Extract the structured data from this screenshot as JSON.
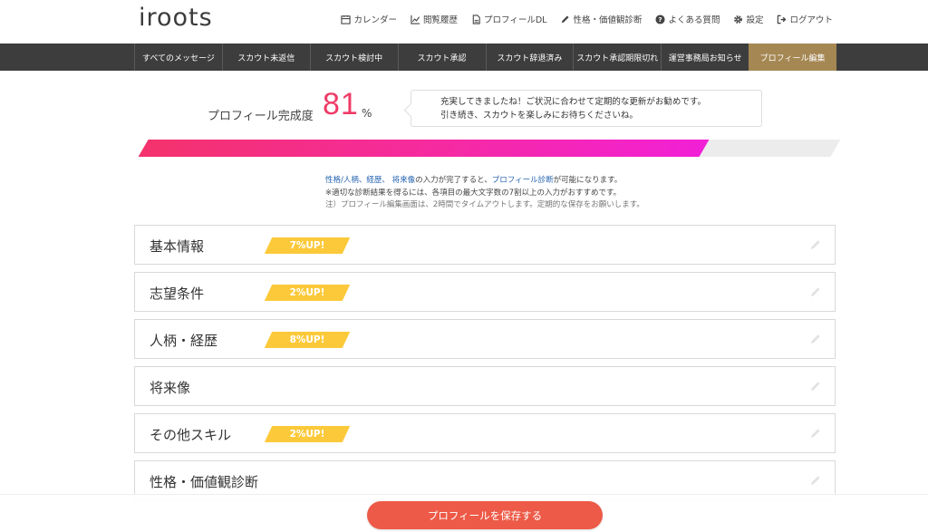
{
  "header": {
    "logo": "iroots",
    "nav": [
      {
        "label": "カレンダー",
        "icon": "calendar-icon"
      },
      {
        "label": "閲覧履歴",
        "icon": "chart-icon"
      },
      {
        "label": "プロフィールDL",
        "icon": "pdf-icon"
      },
      {
        "label": "性格・価値観診断",
        "icon": "pencil-icon"
      },
      {
        "label": "よくある質問",
        "icon": "question-icon"
      },
      {
        "label": "設定",
        "icon": "gear-icon"
      },
      {
        "label": "ログアウト",
        "icon": "logout-icon"
      }
    ]
  },
  "tabs": [
    {
      "label": "すべてのメッセージ",
      "active": false
    },
    {
      "label": "スカウト未返信",
      "active": false
    },
    {
      "label": "スカウト検討中",
      "active": false
    },
    {
      "label": "スカウト承認",
      "active": false
    },
    {
      "label": "スカウト辞退済み",
      "active": false
    },
    {
      "label": "スカウト承認期限切れ",
      "active": false
    },
    {
      "label": "運営事務局お知らせ",
      "active": false
    },
    {
      "label": "プロフィール編集",
      "active": true
    }
  ],
  "completion": {
    "label": "プロフィール完成度",
    "value": "81",
    "unit": "%",
    "percent": 81,
    "message_line1": "充実してきましたね！ご状況に合わせて定期的な更新がお勧めです。",
    "message_line2": "引き続き、スカウトを楽しみにお待ちくださいね。"
  },
  "notes": {
    "link1": "性格/人柄、経歴、 将来像",
    "mid1": "の入力が完了すると、",
    "link2": "プロフィール診断",
    "end1": "が可能になります。",
    "line2": "※適切な診断結果を得るには、各項目の最大文字数の7割以上の入力がおすすめです。",
    "line3": "注）プロフィール編集画面は、2時間でタイムアウトします。定期的な保存をお願いします。"
  },
  "sections": [
    {
      "title": "基本情報",
      "badge": "7%UP!"
    },
    {
      "title": "志望条件",
      "badge": "2%UP!"
    },
    {
      "title": "人柄・経歴",
      "badge": "8%UP!"
    },
    {
      "title": "将来像",
      "badge": ""
    },
    {
      "title": "その他スキル",
      "badge": "2%UP!"
    },
    {
      "title": "性格・価値観診断",
      "badge": ""
    }
  ],
  "save_button": "プロフィールを保存する",
  "colors": {
    "accent": "#ef3b67",
    "tab_active": "#a58753",
    "badge": "#fcc93a",
    "save": "#ed5a47"
  }
}
